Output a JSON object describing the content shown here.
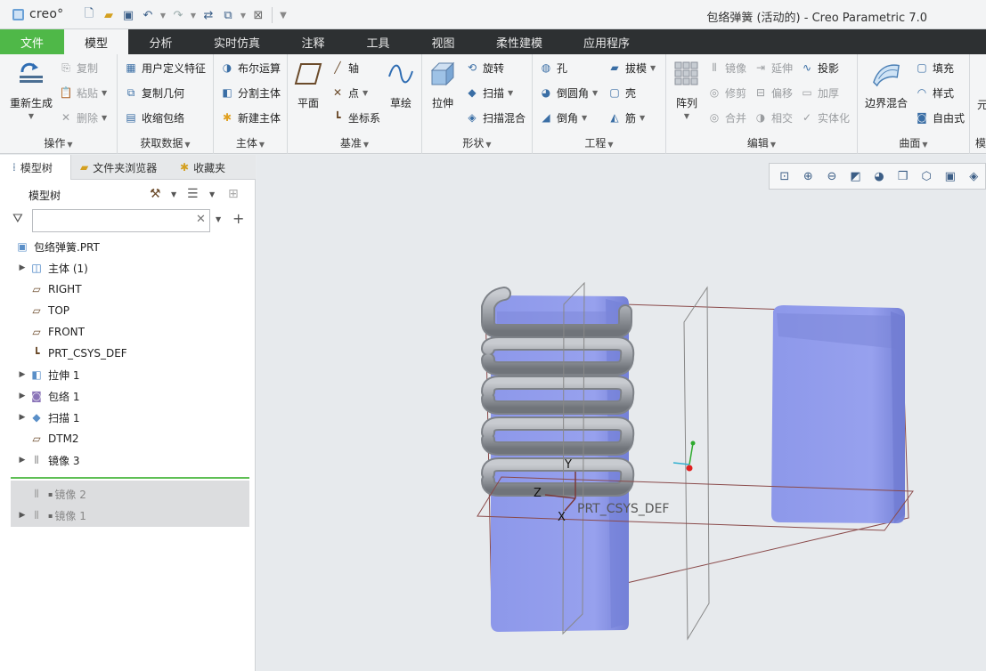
{
  "app": {
    "logo_text": "creo°",
    "window_title": "包络弹簧 (活动的) - Creo Parametric 7.0"
  },
  "quick_access": [
    "new-icon",
    "open-icon",
    "save-icon",
    "undo-icon",
    "redo-icon",
    "regenerate-icon",
    "windows-icon",
    "close-window-icon",
    "customize-icon"
  ],
  "tabs": [
    {
      "label": "文件"
    },
    {
      "label": "模型"
    },
    {
      "label": "分析"
    },
    {
      "label": "实时仿真"
    },
    {
      "label": "注释"
    },
    {
      "label": "工具"
    },
    {
      "label": "视图"
    },
    {
      "label": "柔性建模"
    },
    {
      "label": "应用程序"
    }
  ],
  "ribbon": {
    "ops": {
      "title": "操作",
      "regen": "重新生成",
      "copy": "复制",
      "paste": "粘贴",
      "delete": "删除"
    },
    "getdata": {
      "title": "获取数据",
      "udf": "用户定义特征",
      "copygeom": "复制几何",
      "shrinkwrap": "收缩包络"
    },
    "body": {
      "title": "主体",
      "boolean": "布尔运算",
      "split": "分割主体",
      "newbody": "新建主体"
    },
    "datum": {
      "title": "基准",
      "plane": "平面",
      "axis": "轴",
      "point": "点",
      "csys": "坐标系",
      "sketch": "草绘"
    },
    "shapes": {
      "title": "形状",
      "extrude": "拉伸",
      "revolve": "旋转",
      "sweep": "扫描",
      "sweepblend": "扫描混合"
    },
    "engineering": {
      "title": "工程",
      "hole": "孔",
      "draft": "拔模",
      "round": "倒圆角",
      "shell": "壳",
      "chamfer": "倒角",
      "rib": "筋"
    },
    "editing": {
      "title": "编辑",
      "pattern": "阵列",
      "mirror": "镜像",
      "extend": "延伸",
      "project": "投影",
      "trim": "修剪",
      "offset": "偏移",
      "thicken": "加厚",
      "merge": "合并",
      "intersect": "相交",
      "solidify": "实体化"
    },
    "surfaces": {
      "title": "曲面",
      "boundary": "边界混合",
      "fill": "填充",
      "style": "样式",
      "freestyle": "自由式"
    },
    "model_intent_partial": {
      "title": "模",
      "label": "元"
    }
  },
  "left_panel": {
    "tabs": [
      {
        "label": "模型树"
      },
      {
        "label": "文件夹浏览器"
      },
      {
        "label": "收藏夹"
      }
    ],
    "tree_title": "模型树",
    "filter_placeholder": "",
    "items": [
      {
        "label": "包络弹簧.PRT",
        "icon": "part-icon",
        "expandable": false
      },
      {
        "label": "主体 (1)",
        "icon": "body-icon",
        "expandable": true
      },
      {
        "label": "RIGHT",
        "icon": "datum-plane-icon",
        "expandable": false
      },
      {
        "label": "TOP",
        "icon": "datum-plane-icon",
        "expandable": false
      },
      {
        "label": "FRONT",
        "icon": "datum-plane-icon",
        "expandable": false
      },
      {
        "label": "PRT_CSYS_DEF",
        "icon": "csys-icon",
        "expandable": false
      },
      {
        "label": "拉伸 1",
        "icon": "extrude-icon",
        "expandable": true
      },
      {
        "label": "包络 1",
        "icon": "wrap-icon",
        "expandable": true
      },
      {
        "label": "扫描 1",
        "icon": "sweep-icon",
        "expandable": true
      },
      {
        "label": "DTM2",
        "icon": "datum-plane-icon",
        "expandable": false
      },
      {
        "label": "镜像 3",
        "icon": "mirror-icon",
        "expandable": true
      }
    ],
    "suppressed_items": [
      {
        "label": "镜像 2",
        "icon": "mirror-icon",
        "expandable": false
      },
      {
        "label": "镜像 1",
        "icon": "mirror-icon",
        "expandable": true
      }
    ]
  },
  "graphics": {
    "view_toolbar": [
      "refit-icon",
      "zoom-in-icon",
      "zoom-out-icon",
      "repaint-icon",
      "display-style-icon",
      "saved-orientations-icon",
      "view-manager-icon",
      "perspective-icon",
      "datum-display-icon"
    ],
    "csys_axes": {
      "y": "Y",
      "z": "Z",
      "x": "X"
    },
    "csys_name": "PRT_CSYS_DEF",
    "colors": {
      "solid": "#8f9ae9",
      "solid_dark": "#7c86d8",
      "coil": "#a9adb3",
      "coil_dark": "#7e8288",
      "datum": "#7a3a3a",
      "background": "#e7eaed"
    }
  }
}
